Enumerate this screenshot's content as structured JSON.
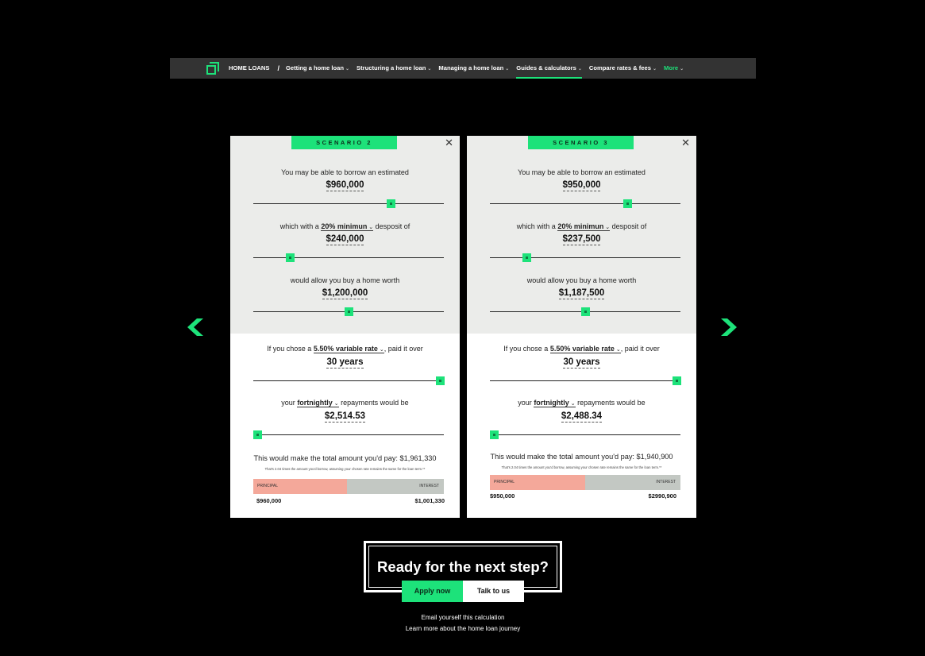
{
  "nav": {
    "home": "HOME LOANS",
    "sep": "/",
    "items": [
      {
        "label": "Getting a home loan"
      },
      {
        "label": "Structuring a home loan"
      },
      {
        "label": "Managing a home loan"
      },
      {
        "label": "Guides & calculators"
      },
      {
        "label": "Compare rates & fees"
      },
      {
        "label": "More"
      }
    ],
    "accent": "#1de27a"
  },
  "scenarios": [
    {
      "tag": "SCENARIO 2",
      "borrow_text": "You may be able to borrow an estimated",
      "borrow_value": "$960,000",
      "deposit_pre": "which with a",
      "deposit_option": "20% minimun",
      "deposit_post": "desposit of",
      "deposit_value": "$240,000",
      "worth_text": "would allow you buy a home worth",
      "worth_value": "$1,200,000",
      "rate_pre": "If you chose a",
      "rate_option": "5.50% variable rate",
      "rate_post": ", paid it over",
      "term_value": "30 years",
      "repay_pre": "your",
      "repay_option": "fortnightly",
      "repay_post": "repayments would be",
      "repay_value": "$2,514.53",
      "total_text": "This would make the total amount you'd pay: $1,961,330",
      "note": "That's 2.04 times the amount you'd borrow, assuming your chosen rate remains the same for the loan term.**",
      "principal_label": "PRINCIPAL",
      "interest_label": "INTEREST",
      "principal_amount": "$960,000",
      "interest_amount": "$1,001,330",
      "principal_share": 0.49,
      "sliders": {
        "borrow": 0.72,
        "deposit": 0.19,
        "worth": 0.5,
        "term": 0.98,
        "repay": 0.02
      }
    },
    {
      "tag": "SCENARIO 3",
      "borrow_text": "You may be able to borrow an estimated",
      "borrow_value": "$950,000",
      "deposit_pre": "which with a",
      "deposit_option": "20% minimun",
      "deposit_post": "desposit of",
      "deposit_value": "$237,500",
      "worth_text": "would allow you buy a home worth",
      "worth_value": "$1,187,500",
      "rate_pre": "If you chose a",
      "rate_option": "5.50% variable rate",
      "rate_post": ", paid it over",
      "term_value": "30 years",
      "repay_pre": "your",
      "repay_option": "fortnightly",
      "repay_post": "repayments would be",
      "repay_value": "$2,488.34",
      "total_text": "This would make the total amount you'd pay: $1,940,900",
      "note": "That's 2.04 times the amount you'd borrow, assuming your chosen rate remains the same for the loan term.**",
      "principal_label": "PRINCIPAL",
      "interest_label": "INTEREST",
      "principal_amount": "$950,000",
      "interest_amount": "$2990,900",
      "principal_share": 0.5,
      "sliders": {
        "borrow": 0.72,
        "deposit": 0.19,
        "worth": 0.5,
        "term": 0.98,
        "repay": 0.02
      }
    }
  ],
  "cta": {
    "title": "Ready for the next step?",
    "apply": "Apply now",
    "talk": "Talk to us",
    "email_link": "Email yourself this calculation",
    "learn_link": "Learn more about the home loan journey"
  },
  "icons": {
    "close": "close-icon",
    "prev": "chevron-left-icon",
    "next": "chevron-right-icon"
  }
}
